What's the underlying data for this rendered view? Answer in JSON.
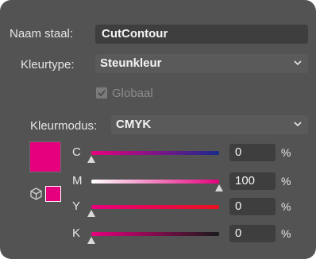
{
  "swatch": {
    "name_label": "Naam staal:",
    "name_value": "CutContour",
    "colortype_label": "Kleurtype:",
    "colortype_value": "Steunkleur",
    "global_label": "Globaal",
    "global_checked": true,
    "global_enabled": false,
    "colormode_label": "Kleurmodus:",
    "colormode_value": "CMYK",
    "color_hex": "#e6007e"
  },
  "channels": [
    {
      "label": "C",
      "value": "0",
      "unit": "%",
      "fraction": 0.0,
      "gradient": [
        "#e6007e",
        "#1a2a8e"
      ]
    },
    {
      "label": "M",
      "value": "100",
      "unit": "%",
      "fraction": 1.0,
      "gradient": [
        "#ffffff",
        "#e6007e"
      ]
    },
    {
      "label": "Y",
      "value": "0",
      "unit": "%",
      "fraction": 0.0,
      "gradient": [
        "#e6007e",
        "#e8141e"
      ]
    },
    {
      "label": "K",
      "value": "0",
      "unit": "%",
      "fraction": 0.0,
      "gradient": [
        "#e6007e",
        "#1a1a1a"
      ]
    }
  ],
  "icons": {
    "dropdown": "chevron-down-icon",
    "checkbox": "checkmark-icon",
    "out_of_web": "cube-icon"
  }
}
